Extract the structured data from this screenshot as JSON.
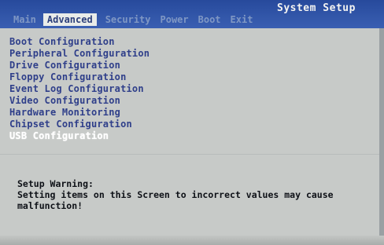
{
  "header": {
    "title": "System Setup",
    "tabs": [
      {
        "label": "Main"
      },
      {
        "label": "Advanced"
      },
      {
        "label": "Security"
      },
      {
        "label": "Power"
      },
      {
        "label": "Boot"
      },
      {
        "label": "Exit"
      }
    ],
    "active_tab": "Advanced"
  },
  "menu": {
    "items": [
      {
        "label": "Boot Configuration"
      },
      {
        "label": "Peripheral Configuration"
      },
      {
        "label": "Drive Configuration"
      },
      {
        "label": "Floppy Configuration"
      },
      {
        "label": "Event Log Configuration"
      },
      {
        "label": "Video Configuration"
      },
      {
        "label": "Hardware Monitoring"
      },
      {
        "label": "Chipset Configuration"
      },
      {
        "label": "USB Configuration"
      }
    ],
    "selected_item": "USB Configuration"
  },
  "warning": {
    "title": "Setup Warning:",
    "line1": "Setting items on this Screen to incorrect values may cause",
    "line2": "malfunction!"
  },
  "colors": {
    "header_bg": "#2b4fa0",
    "active_tab_bg": "#e9ece9",
    "inactive_tab_text": "#7f97c4",
    "body_bg": "#c7cac8",
    "menu_text": "#2f3f8a",
    "selected_text": "#ffffff",
    "warning_text": "#0e1117"
  }
}
